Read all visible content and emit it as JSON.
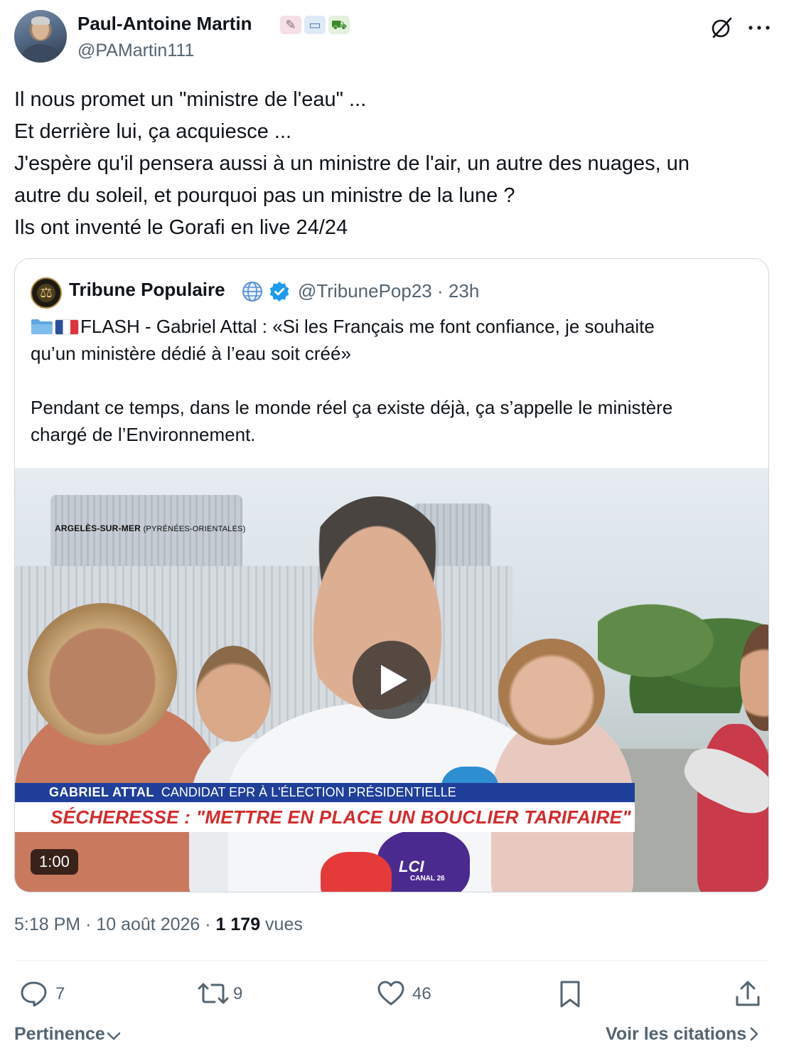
{
  "author": {
    "name": "Paul-Antoine Martin",
    "emojis": [
      "pen-emoji",
      "book-emoji",
      "tractor-emoji"
    ],
    "handle": "@PAMartin111"
  },
  "tweet": {
    "lines": [
      "Il nous promet un \"ministre de l'eau\" ...",
      "Et derrière lui, ça acquiesce ...",
      "J'espère qu'il pensera aussi à un ministre de l'air, un autre des nuages, un",
      "autre du soleil, et pourquoi pas un ministre de la lune ?",
      "Ils ont inventé le Gorafi en live 24/24"
    ]
  },
  "quote": {
    "name": "Tribune Populaire",
    "handle": "@TribunePop23",
    "time": "· 23h",
    "line1_text": "FLASH - Gabriel Attal : «Si les Français me font confiance, je souhaite",
    "line2": "qu’un ministère dédié à l’eau soit créé»",
    "line3": "",
    "line4": "Pendant ce temps, dans le monde réel ça existe déjà, ça s’appelle le ministère",
    "line5": "chargé de l’Environnement."
  },
  "video": {
    "location": "ARGELÈS-SUR-MER",
    "location_detail": "(PYRÉNÉES-ORIENTALES)",
    "speaker": "GABRIEL ATTAL",
    "speaker_role": "CANDIDAT EPR À L'ÉLECTION PRÉSIDENTIELLE",
    "headline": "SÉCHERESSE : \"METTRE EN PLACE UN BOUCLIER TARIFAIRE\"",
    "duration": "1:00",
    "channel_logo": "LCI",
    "channel_sub": "CANAL 26"
  },
  "meta": {
    "time": "5:18 PM",
    "date": "· 10 août 2026 ·",
    "views_count": "1 179",
    "views_label": "vues"
  },
  "actions": {
    "replies": "7",
    "reposts": "9",
    "likes": "46"
  },
  "footer": {
    "sort_label": "Pertinence",
    "quotes_label": "Voir les citations"
  },
  "colors": {
    "text": "#0f1419",
    "secondary": "#536471",
    "border": "#cfd9de",
    "verified": "#1d9bf0",
    "news_blue": "#1f3f9a",
    "news_red": "#d42a2a"
  }
}
